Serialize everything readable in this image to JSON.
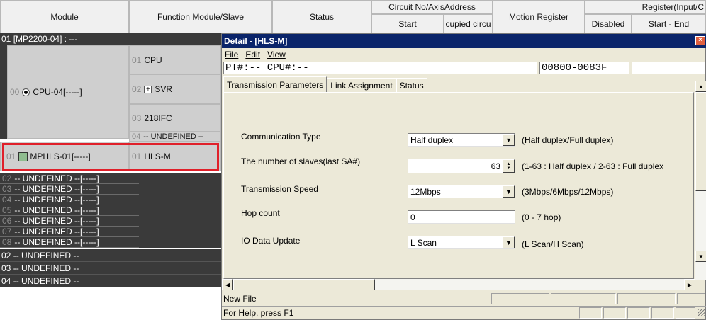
{
  "header": {
    "module": "Module",
    "function_slave": "Function Module/Slave",
    "status": "Status",
    "circuit_axis": "Circuit No/AxisAddress",
    "start": "Start",
    "occupied": "cupied circu",
    "motion_register": "Motion Register",
    "register_io": "Register(Input/C",
    "disabled": "Disabled",
    "start_end": "Start - End"
  },
  "tree": {
    "root": {
      "num": "01",
      "label": "[MP2200-04] : ---"
    },
    "cpu_module": {
      "num": "00",
      "label": "CPU-04[-----]"
    },
    "cpu_children": [
      {
        "num": "01",
        "label": "CPU"
      },
      {
        "num": "02",
        "label": "SVR"
      },
      {
        "num": "03",
        "label": "218IFC"
      },
      {
        "num": "04",
        "label": "-- UNDEFINED --"
      }
    ],
    "mphls": {
      "num": "01",
      "label": "MPHLS-01[-----]",
      "child_num": "01",
      "child_label": "HLS-M"
    },
    "undefined_slots": [
      {
        "num": "02",
        "label": "-- UNDEFINED --[-----]"
      },
      {
        "num": "03",
        "label": "-- UNDEFINED --[-----]"
      },
      {
        "num": "04",
        "label": "-- UNDEFINED --[-----]"
      },
      {
        "num": "05",
        "label": "-- UNDEFINED --[-----]"
      },
      {
        "num": "06",
        "label": "-- UNDEFINED --[-----]"
      },
      {
        "num": "07",
        "label": "-- UNDEFINED --[-----]"
      },
      {
        "num": "08",
        "label": "-- UNDEFINED --[-----]"
      }
    ],
    "racks": [
      {
        "num": "02",
        "label": "-- UNDEFINED --"
      },
      {
        "num": "03",
        "label": "-- UNDEFINED --"
      },
      {
        "num": "04",
        "label": "-- UNDEFINED --"
      }
    ]
  },
  "detail": {
    "title": "Detail - [HLS-M]",
    "menu": {
      "file": "File",
      "edit": "Edit",
      "view": "View"
    },
    "pt_cpu": "PT#:-- CPU#:--",
    "address": "00800-0083F",
    "tabs": [
      "Transmission Parameters",
      "Link Assignment",
      "Status"
    ],
    "active_tab": "Transmission Parameters",
    "fields": {
      "comm_type": {
        "label": "Communication Type",
        "value": "Half duplex",
        "hint": "(Half duplex/Full duplex)"
      },
      "num_slaves": {
        "label": "The number of slaves(last SA#)",
        "value": "63",
        "hint": "(1-63 : Half duplex / 2-63 : Full duplex"
      },
      "trans_speed": {
        "label": "Transmission Speed",
        "value": "12Mbps",
        "hint": "(3Mbps/6Mbps/12Mbps)"
      },
      "hop_count": {
        "label": "Hop count",
        "value": "0",
        "hint": "(0 - 7 hop)"
      },
      "io_update": {
        "label": "IO Data Update",
        "value": "L Scan",
        "hint": "(L Scan/H Scan)"
      }
    },
    "status_file": "New File",
    "status_help": "For Help, press F1"
  },
  "colors": {
    "highlight": "#e0202a",
    "title_bar": "#0a246a",
    "tree_bg": "#3a3a3a"
  }
}
